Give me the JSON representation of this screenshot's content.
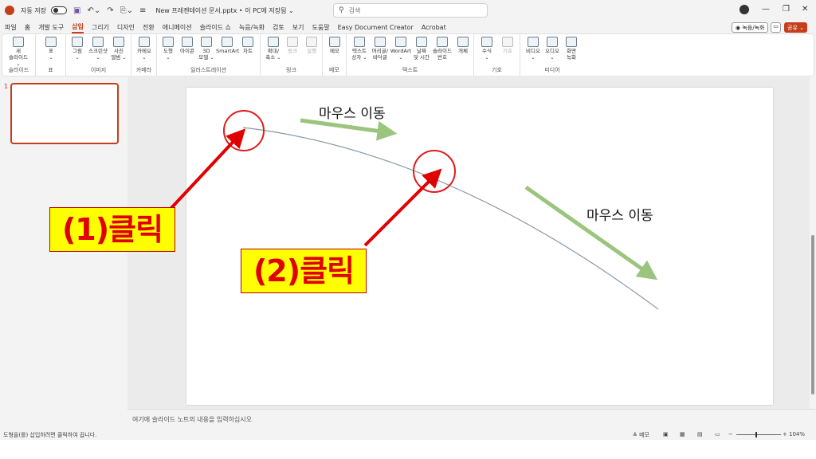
{
  "titlebar": {
    "autosave_label": "자동 저장",
    "doc_title": "New 프레젠테이션 문서.pptx • 이 PC에 저장됨 ⌄",
    "search_placeholder": "검색",
    "minimize": "—",
    "restore": "❐",
    "close": "✕"
  },
  "menu_tabs": [
    "파일",
    "홈",
    "개발 도구",
    "삽입",
    "그리기",
    "디자인",
    "전환",
    "애니메이션",
    "슬라이드 쇼",
    "녹음/녹화",
    "검토",
    "보기",
    "도움말",
    "Easy Document Creator",
    "Acrobat"
  ],
  "active_tab": "삽입",
  "top_right": {
    "record": "◉ 녹음/녹화",
    "comment": "▭",
    "share": "공유 ⌄"
  },
  "ribbon": {
    "groups": [
      {
        "label": "슬라이드",
        "items": [
          "새\n슬라이드 ⌄"
        ]
      },
      {
        "label": "표",
        "items": [
          "표\n⌄"
        ]
      },
      {
        "label": "이미지",
        "items": [
          "그림\n⌄",
          "스크린샷\n⌄",
          "사진\n앨범 ⌄"
        ]
      },
      {
        "label": "카메라",
        "items": [
          "카메오\n⌄"
        ]
      },
      {
        "label": "일러스트레이션",
        "items": [
          "도형\n⌄",
          "아이콘",
          "3D\n모델 ⌄",
          "SmartArt",
          "차트"
        ]
      },
      {
        "label": "링크",
        "items": [
          "확대/\n축소 ⌄",
          "링크",
          "실행"
        ]
      },
      {
        "label": "메모",
        "items": [
          "메모"
        ]
      },
      {
        "label": "텍스트",
        "items": [
          "텍스트\n상자 ⌄",
          "머리글/\n바닥글",
          "WordArt\n⌄",
          "날짜\n및 시간",
          "슬라이드\n번호",
          "개체"
        ]
      },
      {
        "label": "기호",
        "items": [
          "수식\n⌄",
          "기호"
        ]
      },
      {
        "label": "미디어",
        "items": [
          "비디오\n⌄",
          "오디오\n⌄",
          "화면\n녹화"
        ]
      }
    ]
  },
  "thumbnail": {
    "number": "1"
  },
  "slide": {
    "callout1": "(1)클릭",
    "callout2": "(2)클릭",
    "move_label1": "마우스 이동",
    "move_label2": "마우스 이동"
  },
  "colors": {
    "accent": "#c43e1c",
    "arrow_red": "#e00000",
    "arrow_green": "#9bc57e",
    "callout_bg": "#ffff00",
    "curve": "#8a9aa8"
  },
  "notes_placeholder": "여기에 슬라이드 노트의 내용을 입력하십시오",
  "status": {
    "text": "도형을(를) 삽입하려면 클릭하여 끕니다.",
    "notes_btn": "≜ 메모",
    "zoom": "104%"
  }
}
